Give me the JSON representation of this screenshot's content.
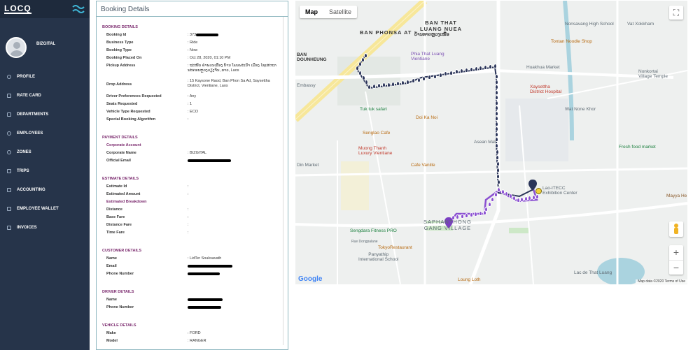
{
  "sidebar": {
    "logo": "LOCQ",
    "profile_name": "BIZGITAL",
    "items": [
      {
        "label": "PROFILE",
        "icon": "user-icon"
      },
      {
        "label": "RATE CARD",
        "icon": "card-icon"
      },
      {
        "label": "DEPARTMENTS",
        "icon": "building-icon"
      },
      {
        "label": "EMPLOYEES",
        "icon": "users-icon"
      },
      {
        "label": "ZONES",
        "icon": "globe-icon"
      },
      {
        "label": "TRIPS",
        "icon": "car-icon"
      },
      {
        "label": "ACCOUNTING",
        "icon": "calculator-icon"
      },
      {
        "label": "EMPLOYEE WALLET",
        "icon": "wallet-icon"
      },
      {
        "label": "INVOICES",
        "icon": "invoice-icon"
      }
    ]
  },
  "booking": {
    "title": "Booking Details",
    "booking_details": {
      "heading": "BOOKING DETAILS",
      "booking_id_label": "Booking Id",
      "booking_id_value": ": 373",
      "business_type_label": "Business Type",
      "business_type_value": ": Ride",
      "booking_type_label": "Booking Type",
      "booking_type_value": ": Now",
      "placed_on_label": "Booking Placed On",
      "placed_on_value": ": Oct 28, 2020, 01:10 PM",
      "pickup_label": "Pickup Address",
      "pickup_value": ": ຖະໜົນ ຄຳພວນເລືອງ ບ້ານ ໂພນພະເນົາ ເມືອງ ໄຊເສດຖາ ນະຄອນຫຼວງວຽງຈັນ, ລາວ, Laos",
      "drop_label": "Drop Address",
      "drop_value": ": 15 Kaysone Raod, Ban Phon Sa Ad, Saysettha District, Vientiane, Laos",
      "driver_pref_label": "Driver Preferences Requested",
      "driver_pref_value": ": Any",
      "seats_label": "Seats Requested",
      "seats_value": ": 1",
      "vehicle_type_label": "Vehicle Type Requested",
      "vehicle_type_value": ": ECO",
      "algorithm_label": "Special Booking Algorithm",
      "algorithm_value": ":"
    },
    "payment_details": {
      "heading": "PAYMENT DETAILS",
      "corporate_account_label": "Corporate Account",
      "corporate_name_label": "Corporate Name",
      "corporate_name_value": ": BIZGITAL",
      "official_email_label": "Official Email",
      "official_email_value": ":"
    },
    "estimate_details": {
      "heading": "ESTIMATE DETAILS",
      "estimate_id_label": "Estimate Id",
      "estimate_id_value": ":",
      "estimated_amount_label": "Estimated Amount",
      "estimated_amount_value": ":",
      "estimated_breakdown_label": "Estimated Breakdown",
      "distance_label": "Distance",
      "distance_value": ":",
      "base_fare_label": "Base Fare",
      "base_fare_value": ":",
      "distance_fare_label": "Distance Fare",
      "distance_fare_value": ":",
      "time_fare_label": "Time Fare",
      "time_fare_value": ":"
    },
    "customer_details": {
      "heading": "CUSTOMER DETAILS",
      "name_label": "Name",
      "name_value": ": LidTer Souksavath",
      "email_label": "Email",
      "email_value": ":",
      "phone_label": "Phone Number",
      "phone_value": ":"
    },
    "driver_details": {
      "heading": "DRIVER DETAILS",
      "name_label": "Name",
      "name_value": ":",
      "phone_label": "Phone Number",
      "phone_value": ":"
    },
    "vehicle_details": {
      "heading": "VEHICLE DETAILS",
      "make_label": "Make",
      "make_value": ": FORD",
      "model_label": "Model",
      "model_value": ": RANGER"
    }
  },
  "map": {
    "toggle_map": "Map",
    "toggle_satellite": "Satellite",
    "zoom_in": "+",
    "zoom_out": "−",
    "google": "Google",
    "attribution": "Map data ©2020   Terms of Use",
    "labels": {
      "ban_phonsa_at": "BAN PHONSA AT",
      "ban_that_luang_nuea": "BAN THAT\nLUANG NUEA",
      "ban_that_luang_nuea_lao": "ບ້ານທາດຫຼວງເໜືອ",
      "nonsavang_school": "Nonsavang High School",
      "vat_xokkham": "Vat Xokkham",
      "tontan": "Tontan Noodle Shop",
      "phia_that_luang": "Phia That Luang\nVientiane",
      "huakhua": "Huakhua Market",
      "nonkortai": "Nonkortai\nVillage Temple",
      "xaysettha_hospital": "Xaysettha\nDistrict Hospital",
      "embassy": "Embassy",
      "tuk_tuk": "Tuk tuk safari",
      "wat_none_khor": "Wat None Khor",
      "senglao": "Senglao Cafe",
      "doi_ka_noi": "Doi Ka Noi",
      "asean_mall": "Asean Mall",
      "fresh_food": "Fresh food market",
      "muong_thanh": "Muong Thanh\nLuxury Vientiane",
      "din_market": "Din Market",
      "cafe_vanille": "Cafe Vanille",
      "itecc": "Lao-ITECC\nExhibition Center",
      "mayya": "Mayya He",
      "saphanthong": "SAPHANTHONG\nGANG VILLAGE",
      "sengdara": "Sengdara Fitness PRO",
      "tokyo": "TokyoRestaurant",
      "panyathip": "Panyathip\nInternational School",
      "loung_loth": "Loung Loth",
      "that_luang_lake": "Lac de That Luang",
      "ban_dounheung": "BAN\nDOUNHEUNG",
      "rue_dongpalane": "Rue Dongpalane"
    }
  }
}
